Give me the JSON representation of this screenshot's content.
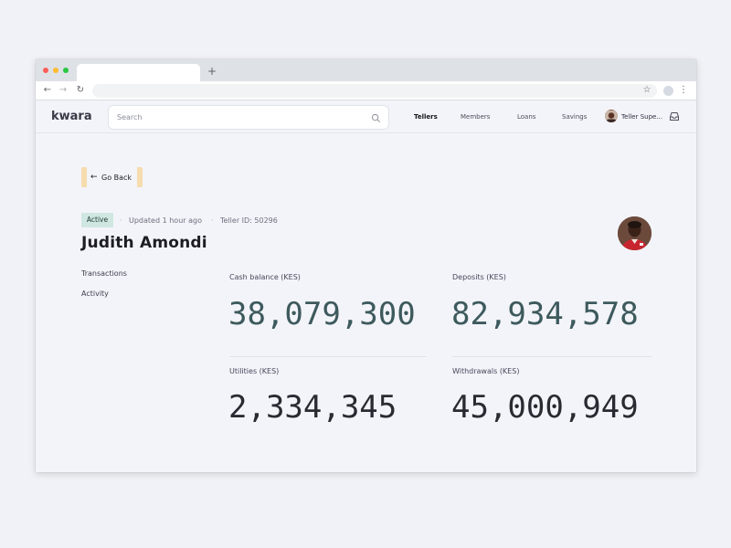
{
  "browser": {
    "new_tab_glyph": "+",
    "back_glyph": "←",
    "forward_glyph": "→",
    "reload_glyph": "↻",
    "star_glyph": "☆",
    "menu_glyph": "⋮"
  },
  "app": {
    "logo": "kwara",
    "search": {
      "placeholder": "Search"
    },
    "nav": [
      {
        "label": "Tellers",
        "active": true
      },
      {
        "label": "Members",
        "active": false
      },
      {
        "label": "Loans",
        "active": false
      },
      {
        "label": "Savings",
        "active": false
      }
    ],
    "user": {
      "name": "Teller Supe..."
    }
  },
  "page": {
    "back_label": "Go Back",
    "back_arrow": "←",
    "status_badge": "Active",
    "updated": "Updated 1 hour ago",
    "teller_id": "Teller ID: 50296",
    "separator": "·",
    "name": "Judith Amondi",
    "side_links": [
      "Transactions",
      "Activity"
    ],
    "stats": [
      {
        "label": "Cash balance (KES)",
        "value": "38,079,300",
        "color": "#3d5a5d"
      },
      {
        "label": "Deposits (KES)",
        "value": "82,934,578",
        "color": "#3d5a5d"
      },
      {
        "label": "Utilities (KES)",
        "value": "2,334,345",
        "color": "#2a2a33"
      },
      {
        "label": "Withdrawals (KES)",
        "value": "45,000,949",
        "color": "#2a2a33"
      }
    ]
  },
  "colors": {
    "badge_bg": "#cfe7e0",
    "goback_accent": "#f6dcae",
    "teal_value": "#3d5a5d"
  }
}
